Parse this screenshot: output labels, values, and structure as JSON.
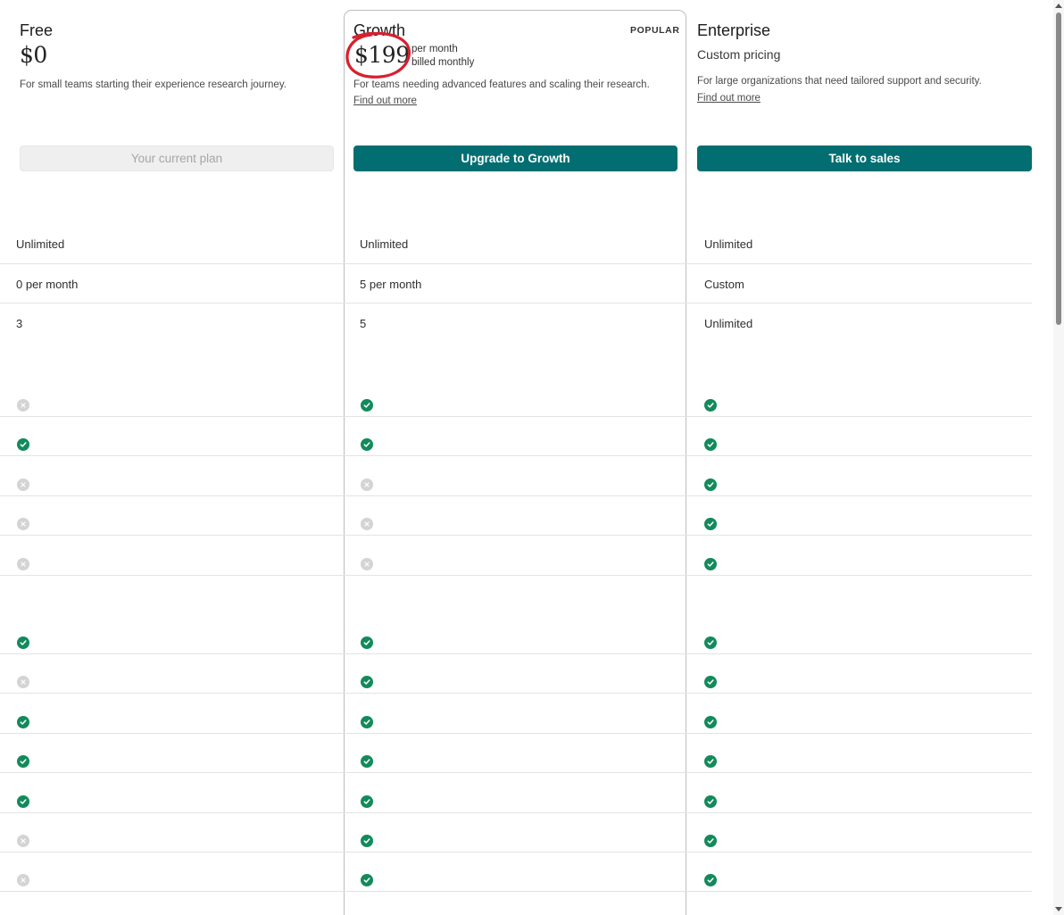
{
  "plans": [
    {
      "name": "Free",
      "price": "$0",
      "description": "For small teams starting their experience research journey.",
      "button": "Your current plan"
    },
    {
      "name": "Growth",
      "badge": "POPULAR",
      "price": "$199",
      "price_period": "per month",
      "price_billing": "billed monthly",
      "description": "For teams needing advanced features and scaling their research.",
      "link": "Find out more",
      "button": "Upgrade to Growth"
    },
    {
      "name": "Enterprise",
      "price_text": "Custom pricing",
      "description": "For large organizations that need tailored support and security.",
      "link": "Find out more",
      "button": "Talk to sales"
    }
  ],
  "text_rows": [
    [
      "Unlimited",
      "Unlimited",
      "Unlimited"
    ],
    [
      "0 per month",
      "5 per month",
      "Custom"
    ],
    [
      "3",
      "5",
      "Unlimited"
    ]
  ],
  "feature_rows_group1": [
    [
      "cross",
      "check",
      "check"
    ],
    [
      "check",
      "check",
      "check"
    ],
    [
      "cross",
      "cross",
      "check"
    ],
    [
      "cross",
      "cross",
      "check"
    ],
    [
      "cross",
      "cross",
      "check"
    ]
  ],
  "feature_rows_group2": [
    [
      "check",
      "check",
      "check"
    ],
    [
      "cross",
      "check",
      "check"
    ],
    [
      "check",
      "check",
      "check"
    ],
    [
      "check",
      "check",
      "check"
    ],
    [
      "check",
      "check",
      "check"
    ],
    [
      "cross",
      "check",
      "check"
    ],
    [
      "cross",
      "check",
      "check"
    ]
  ],
  "colors": {
    "primary": "#036e72",
    "check": "#138a5c",
    "cross": "#d4d4d4",
    "annotation": "#d8202f"
  }
}
